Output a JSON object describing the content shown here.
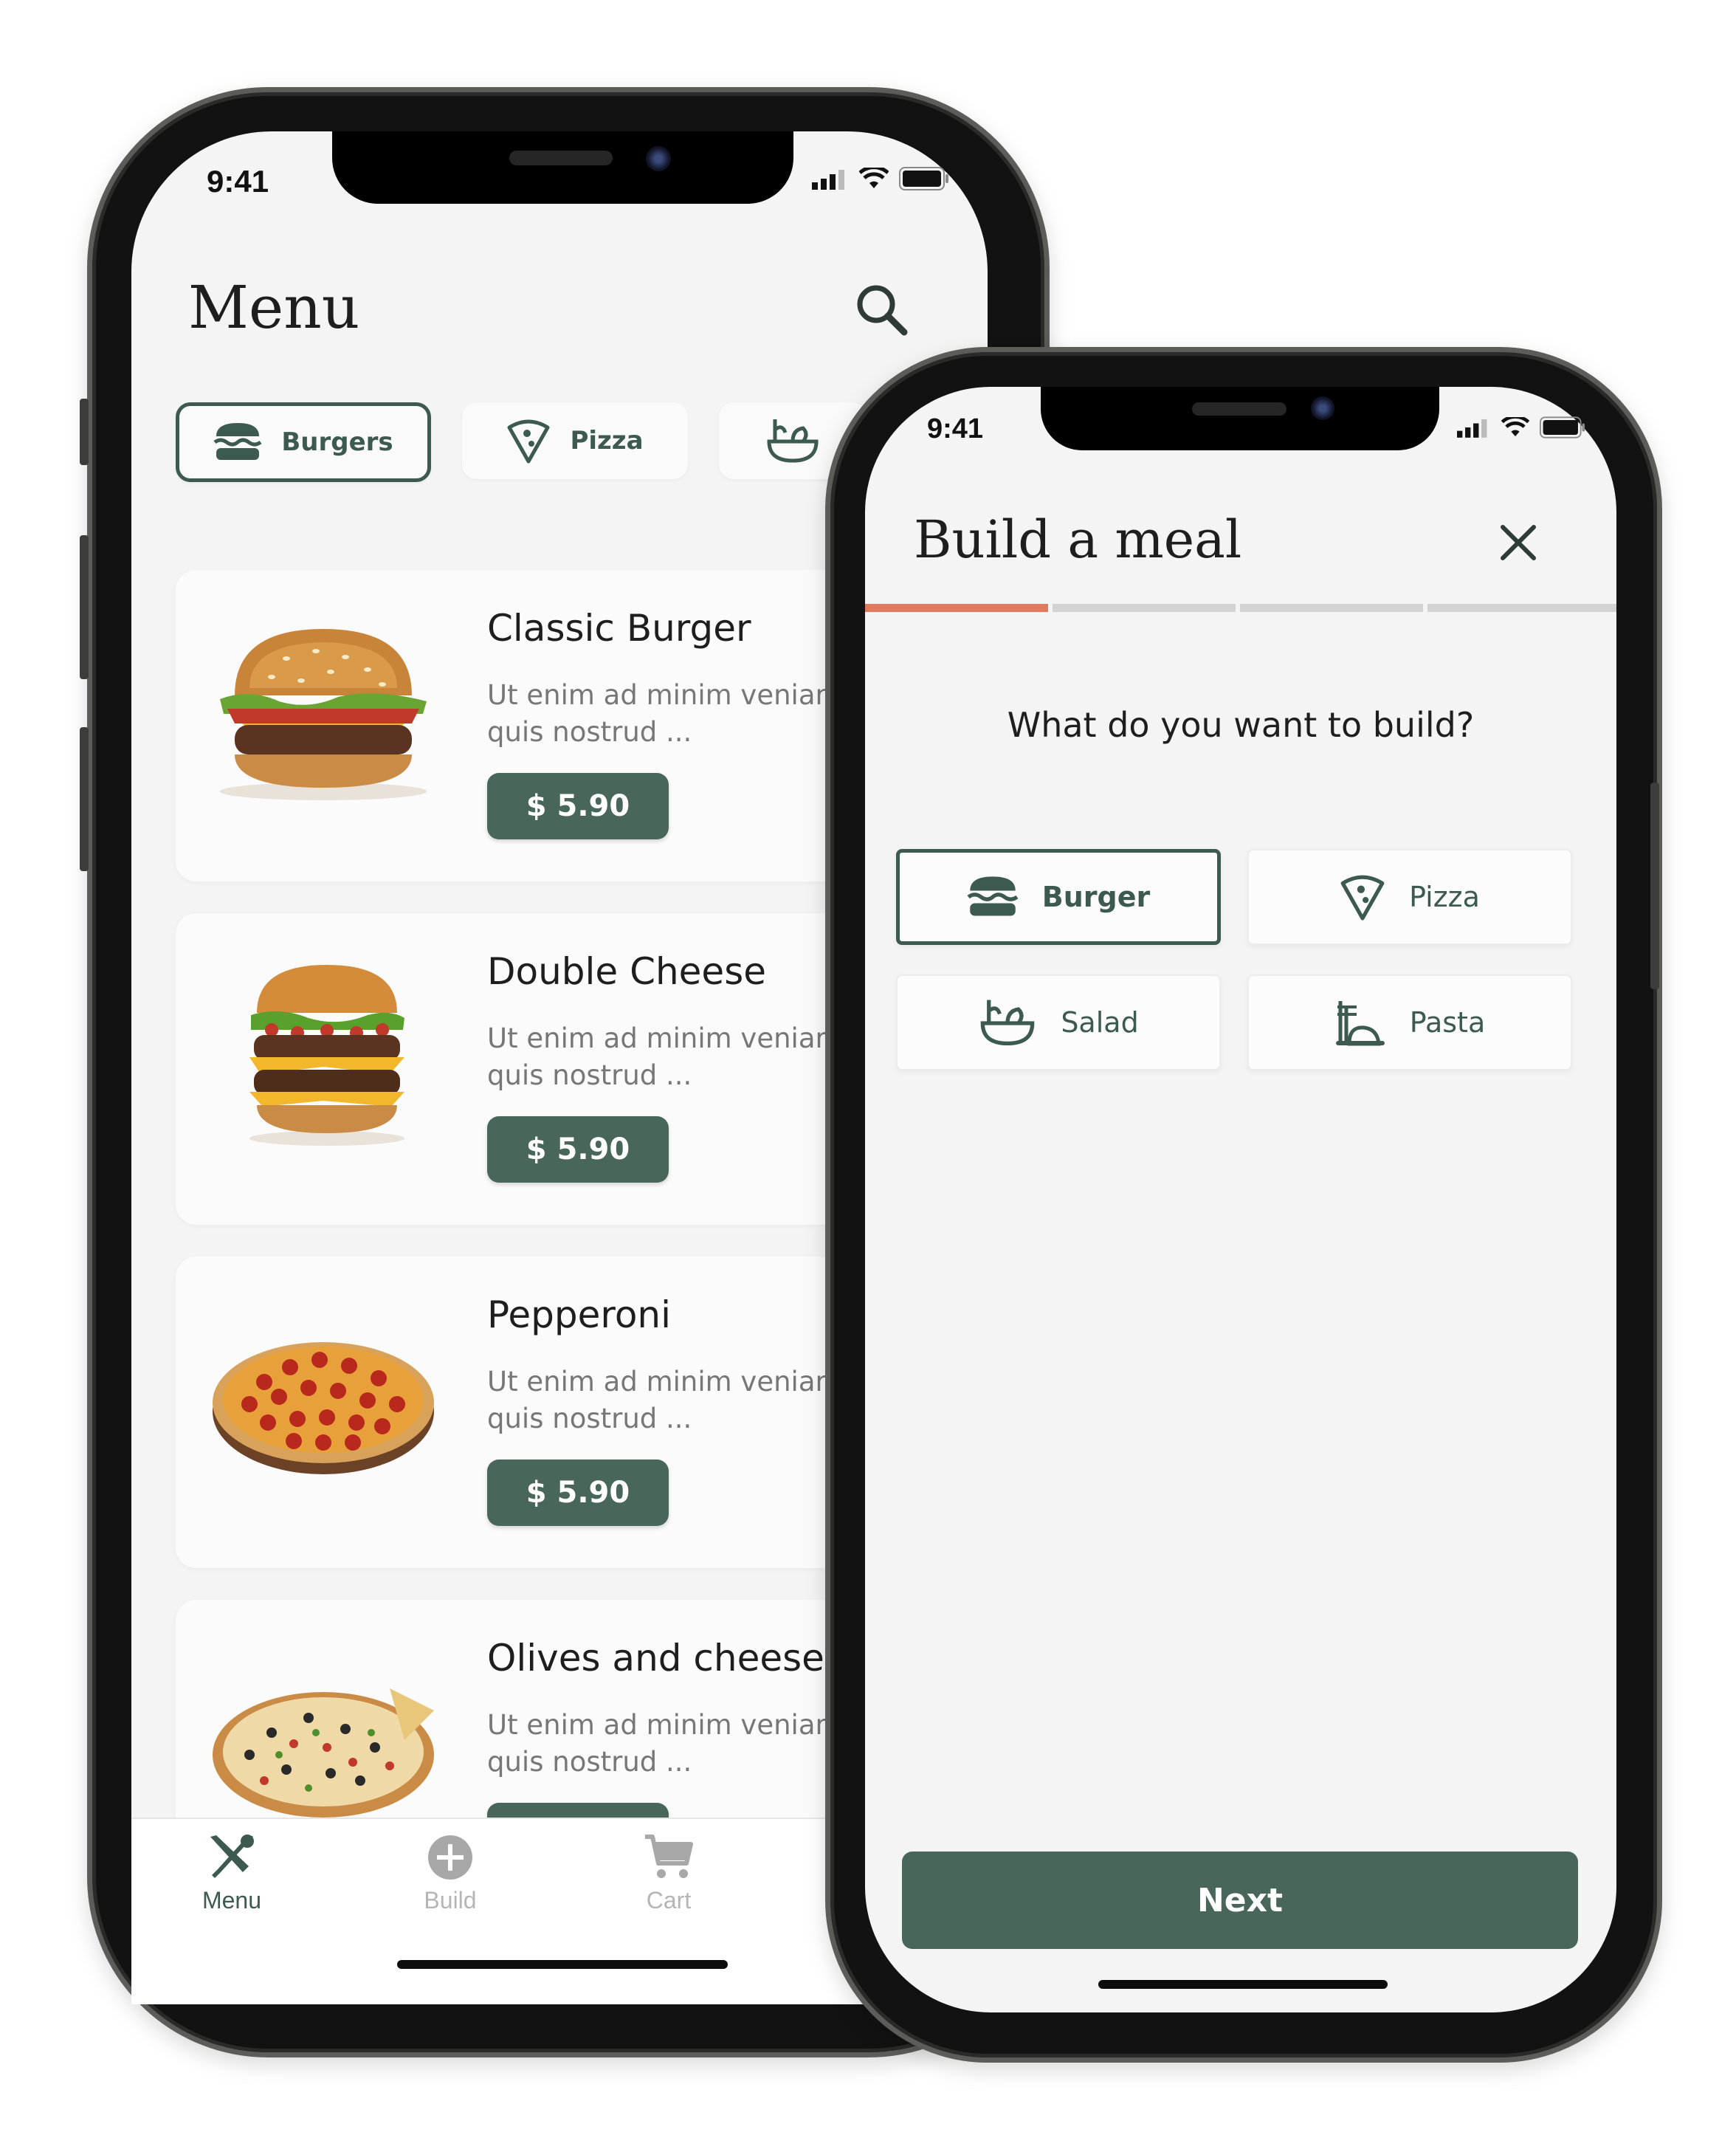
{
  "status_bar": {
    "time": "9:41"
  },
  "menu_screen": {
    "title": "Menu",
    "categories": [
      {
        "label": "Burgers",
        "icon": "burger-icon",
        "active": true
      },
      {
        "label": "Pizza",
        "icon": "pizza-icon",
        "active": false
      },
      {
        "label": "",
        "icon": "salad-icon",
        "active": false
      }
    ],
    "items": [
      {
        "name": "Classic Burger",
        "desc_line1": "Ut enim ad minim veniam,",
        "desc_line2": "quis nostrud ...",
        "price": "$ 5.90",
        "image": "burger-image"
      },
      {
        "name": "Double Cheese",
        "desc_line1": "Ut enim ad minim veniam,",
        "desc_line2": "quis nostrud ...",
        "price": "$ 5.90",
        "image": "double-burger-image"
      },
      {
        "name": "Pepperoni",
        "desc_line1": "Ut enim ad minim veniam,",
        "desc_line2": "quis nostrud ...",
        "price": "$ 5.90",
        "image": "pepperoni-pizza-image"
      },
      {
        "name": "Olives and cheese",
        "desc_line1": "Ut enim ad minim veniam,",
        "desc_line2": "quis nostrud ...",
        "price": "",
        "image": "olive-pizza-image"
      }
    ],
    "bottom_nav": [
      {
        "label": "Menu",
        "icon": "fork-knife-icon",
        "active": true
      },
      {
        "label": "Build",
        "icon": "plus-circle-icon",
        "active": false
      },
      {
        "label": "Cart",
        "icon": "cart-icon",
        "active": false
      }
    ]
  },
  "build_screen": {
    "title": "Build a meal",
    "progress": {
      "step": 1,
      "total": 4
    },
    "question": "What do you want to build?",
    "options": [
      {
        "label": "Burger",
        "icon": "burger-icon",
        "selected": true
      },
      {
        "label": "Pizza",
        "icon": "pizza-icon",
        "selected": false
      },
      {
        "label": "Salad",
        "icon": "salad-icon",
        "selected": false
      },
      {
        "label": "Pasta",
        "icon": "pasta-icon",
        "selected": false
      }
    ],
    "next_label": "Next"
  },
  "colors": {
    "accent": "#48665a",
    "accent_dark": "#3d5a51",
    "progress_active": "#e07a5f",
    "progress_inactive": "#d3d3d3",
    "background": "#f4f4f4"
  }
}
